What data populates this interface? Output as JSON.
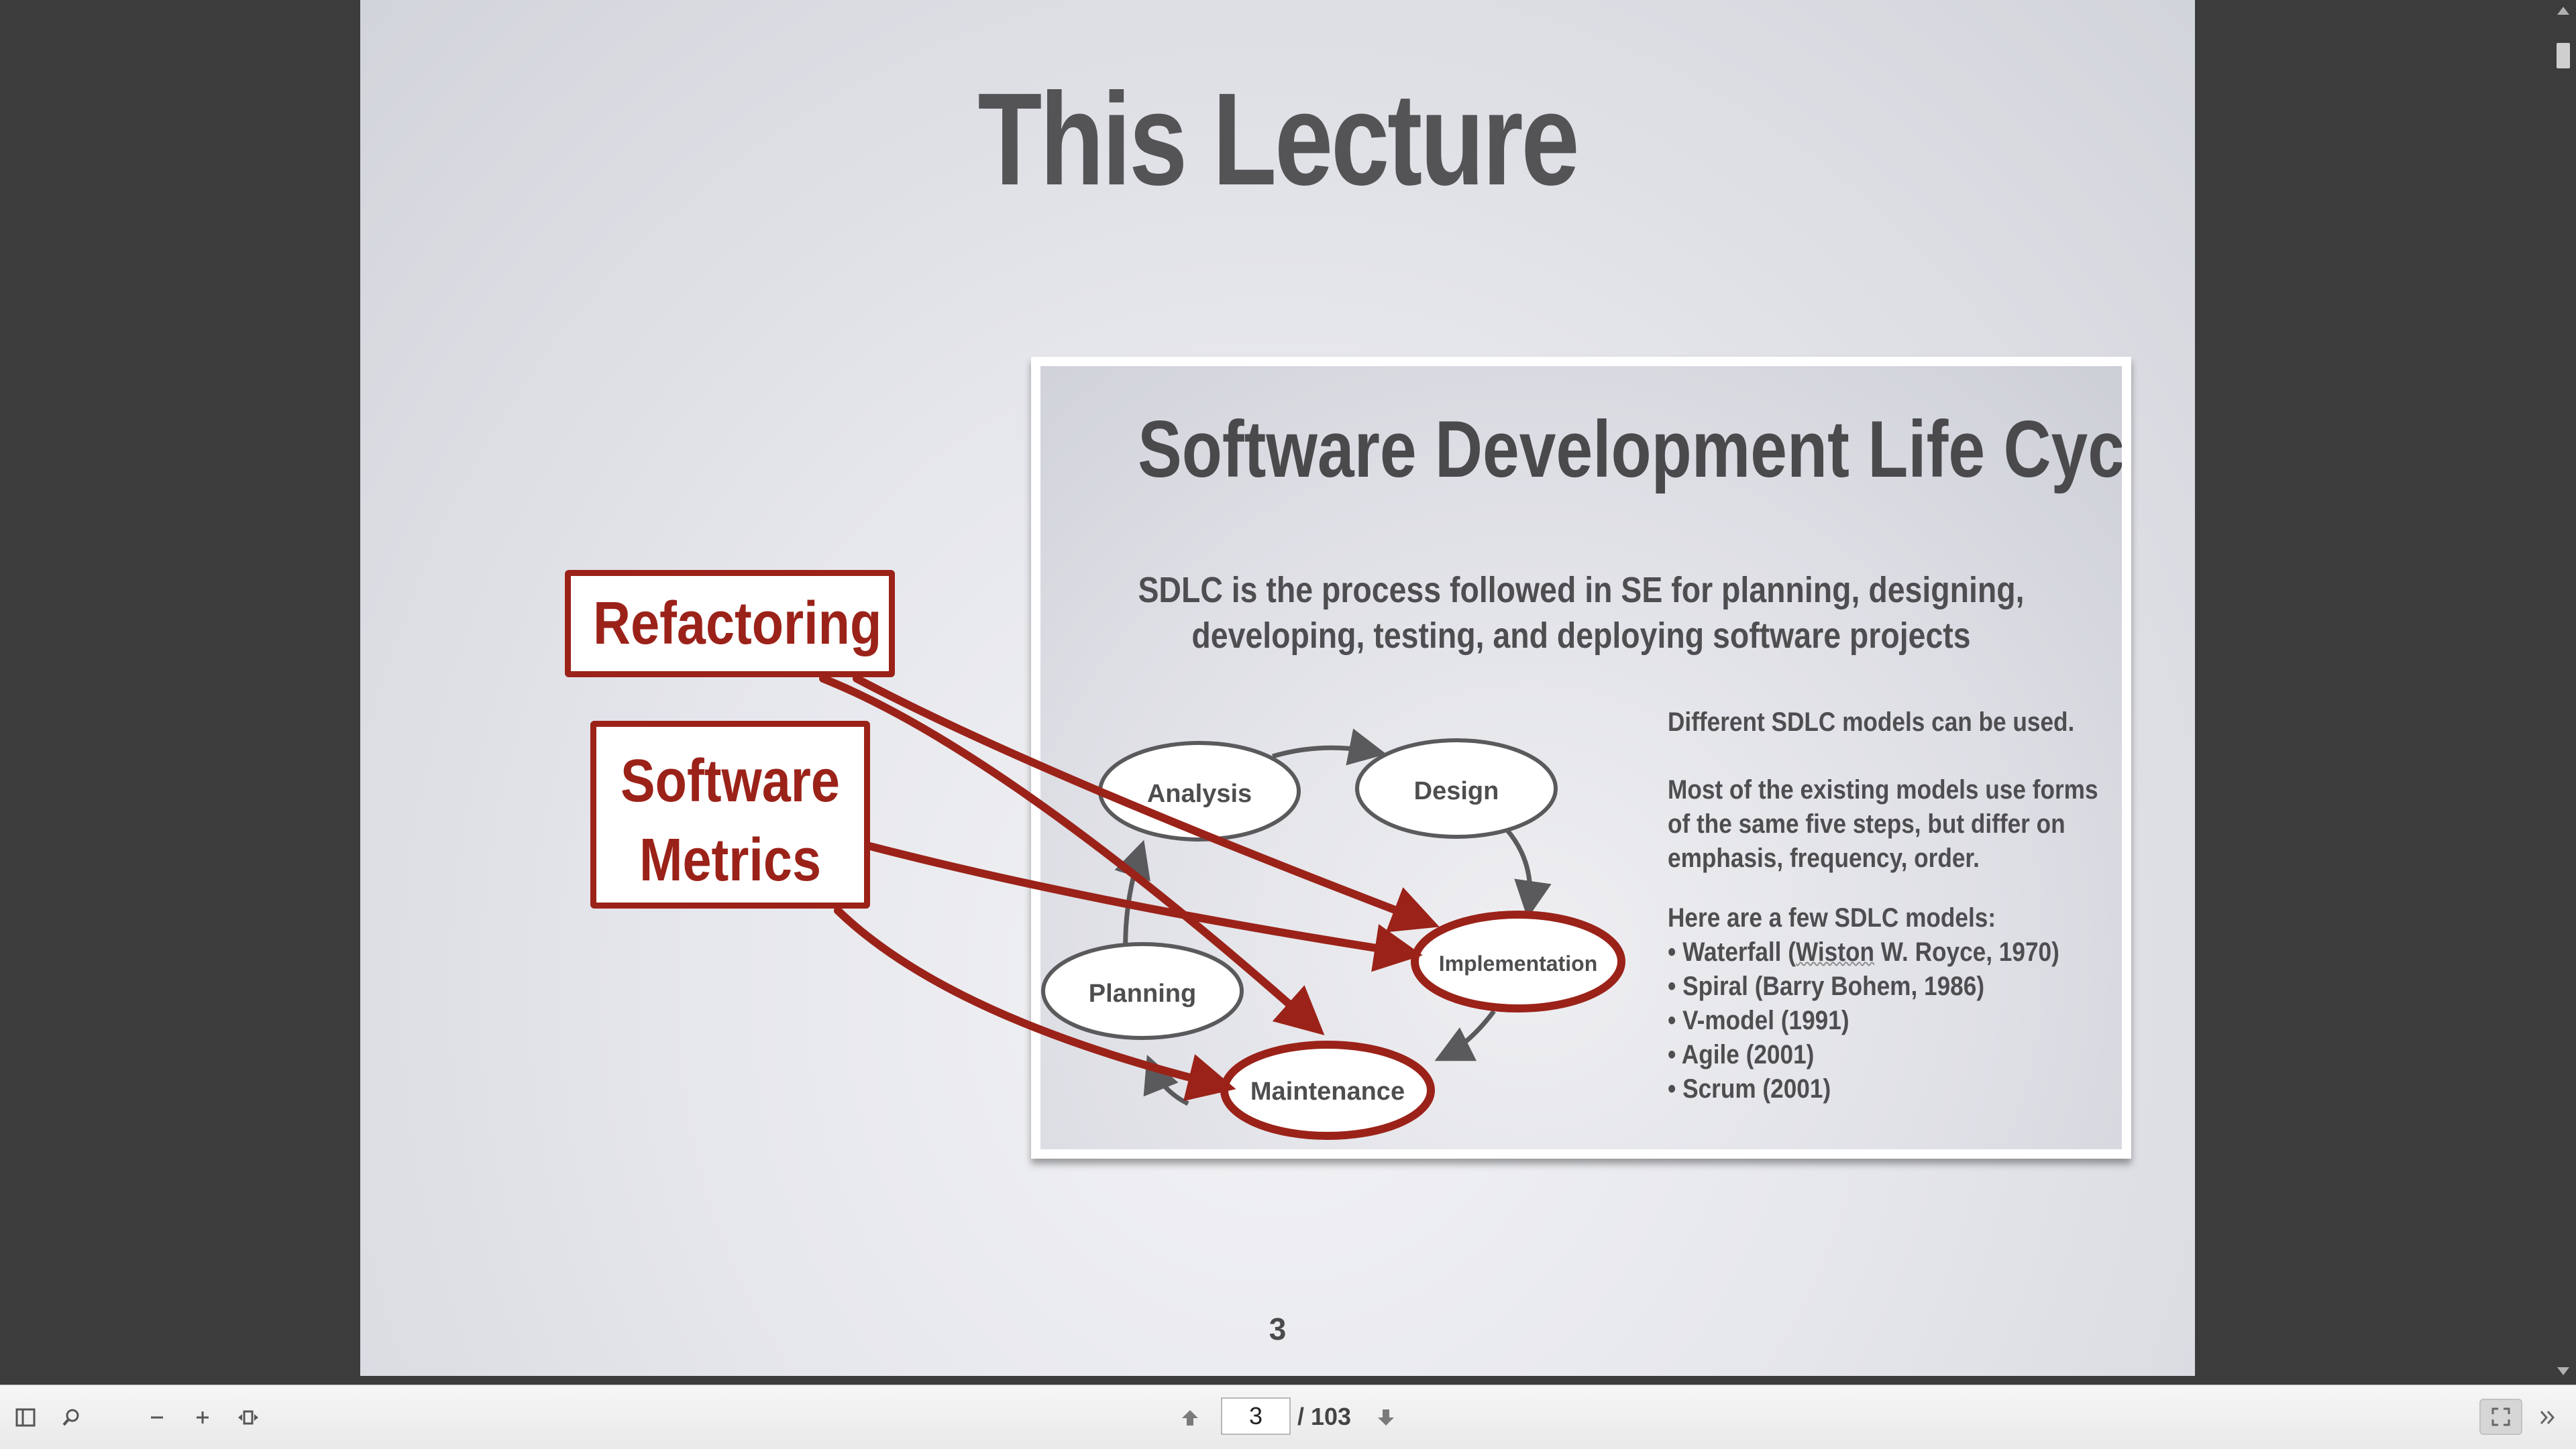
{
  "slide": {
    "title": "This Lecture",
    "page_number": "3",
    "inner_slide": {
      "title": "Software Development Life Cycle",
      "subtitle_line1": "SDLC is the process followed in SE for planning, designing,",
      "subtitle_line2": "developing, testing, and deploying software projects",
      "note1": "Different SDLC models can be used.",
      "note2_line1": "Most of the existing models use forms",
      "note2_line2": "of the same five steps, but differ on",
      "note2_line3": "emphasis, frequency, order.",
      "models_heading": "Here are a few SDLC models:",
      "model_waterfall_prefix": "• Waterfall (",
      "model_waterfall_name": "Wiston",
      "model_waterfall_suffix": " W. Royce, 1970)",
      "model_spiral": "• Spiral (Barry Bohem, 1986)",
      "model_vmodel": "• V-model (1991)",
      "model_agile": "• Agile (2001)",
      "model_scrum": "• Scrum (2001)",
      "steps": {
        "analysis": "Analysis",
        "design": "Design",
        "implementation": "Implementation",
        "maintenance": "Maintenance",
        "planning": "Planning"
      }
    },
    "annotations": {
      "refactoring": "Refactoring",
      "metrics_line1": "Software",
      "metrics_line2": "Metrics",
      "color": "#9b2219"
    }
  },
  "toolbar": {
    "current_page": "3",
    "total_pages": "/ 103"
  },
  "icons": {
    "sidebar_toggle": "sidebar-icon",
    "search": "search-icon",
    "zoom_out": "minus-icon",
    "zoom_in": "plus-icon",
    "fit": "fit-page-icon",
    "prev": "arrow-up-icon",
    "next": "arrow-down-icon",
    "fullscreen": "fullscreen-icon",
    "more": "double-chevron-icon"
  }
}
